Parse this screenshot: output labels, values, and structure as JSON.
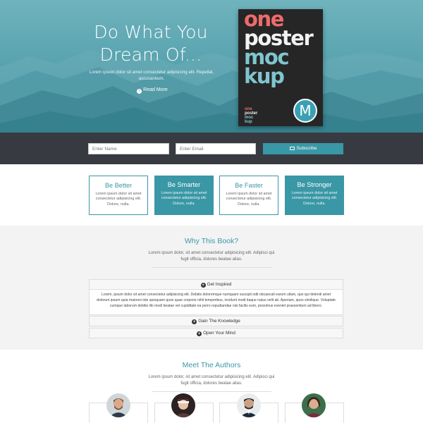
{
  "hero": {
    "title_line1": "Do What You",
    "title_line2": "Dream Of...",
    "subtitle": "Lorem ipsum dolor sit amet consectetur adipisicing elit. Repellat, accusantium.",
    "read_more_label": "Read More",
    "poster": {
      "line1": "one",
      "line2": "poster",
      "line3": "moc",
      "line4": "kup",
      "mini1": "one",
      "mini2": "poster",
      "mini3": "moc",
      "mini4": "kup",
      "badge": "M"
    }
  },
  "subscribe": {
    "name_placeholder": "Enter Name",
    "email_placeholder": "Enter Email",
    "button_label": "Subscribe"
  },
  "features": [
    {
      "title": "Be Better",
      "desc": "Lorem ipsum dolor sit amet consectetur adipisicing elit. Dolore, nulla.",
      "style": "outline"
    },
    {
      "title": "Be Smarter",
      "desc": "Lorem ipsum dolor sit amet consectetur adipisicing elit. Dolore, nulla.",
      "style": "filled"
    },
    {
      "title": "Be Faster",
      "desc": "Lorem ipsum dolor sit amet consectetur adipisicing elit. Dolore, nulla.",
      "style": "outline"
    },
    {
      "title": "Be Stronger",
      "desc": "Lorem ipsum dolor sit amet consectetur adipisicing elit. Dolore, nulla.",
      "style": "filled"
    }
  ],
  "why": {
    "title": "Why This Book?",
    "subtitle": "Lorem ipsum dolor, sit amet consectetur adipisicing elit. Adipisci qui fugit officia, dolores beatae alias.",
    "accordion": [
      {
        "label": "Get Inspired",
        "body": "Lorem, ipsum dolor sit amet consectetur adipisicing elit. Debitis doloremque numquam suscipit odit obcaecati earum ullam, quo qui deleniti amet dolorum ipsum quia maiores iste quisquam quos quae corporis nihil temporibus, incidunt modi itaque natus velit ab. Aperiam, quos similique. Voluptate cumque laborum debitis illo modi beatae vel cupiditate ea porro repudiandae nisi facilis eum, possimus eveniet praesentium ad libero."
      },
      {
        "label": "Gain The Knowledge"
      },
      {
        "label": "Open Your Mind"
      }
    ]
  },
  "authors": {
    "title": "Meet The Authors",
    "subtitle": "Lorem ipsum dolor, sit amet consectetur adipisicing elit. Adipisci qui fugit officia, dolores beatae alias."
  },
  "colors": {
    "accent": "#3a97a6",
    "dark_bar": "#373b41",
    "hero_teal": "#5aa4b0",
    "poster_bg": "#262626",
    "poster_coral": "#ee6b6b"
  }
}
